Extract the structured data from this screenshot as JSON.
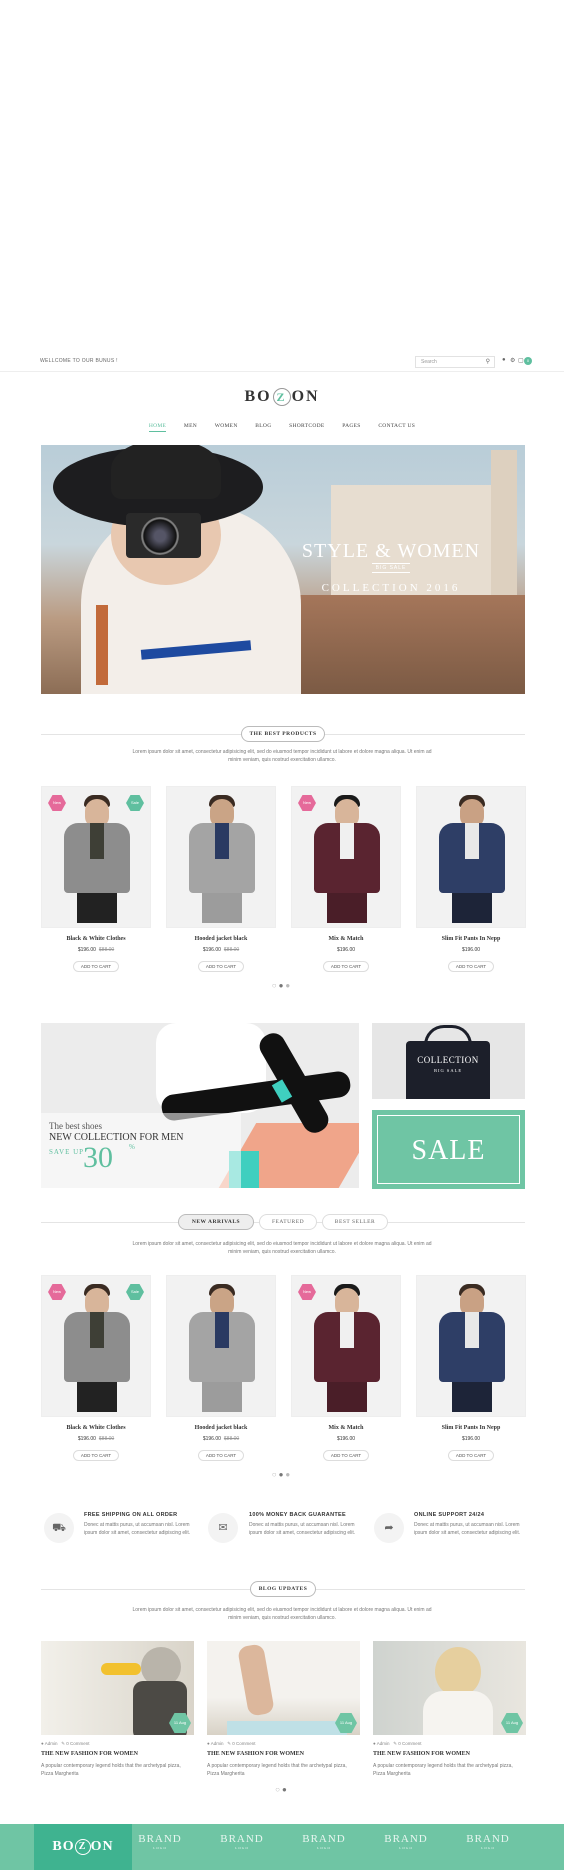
{
  "topbar": {
    "welcome": "WELLCOME TO OUR BUNUS !",
    "search_placeholder": "Search"
  },
  "logo": {
    "left": "BO",
    "center": "Z",
    "right": "ON"
  },
  "nav": [
    "HOME",
    "MEN",
    "WOMEN",
    "BLOG",
    "SHORTCODE",
    "PAGES",
    "CONTACT US"
  ],
  "hero": {
    "title": "STYLE & WOMEN",
    "subtitle": "BIG SALE",
    "collection": "COLLECTION 2016"
  },
  "best_products": {
    "heading": "THE BEST PRODUCTS",
    "description": "Lorem ipsum dolor sit amet, consectetur adipisicing elit, sed do eiusmod tempor incididunt ut labore et dolore magna aliqua. Ut enim ad minim veniam, quis nostrud exercitation ullamco."
  },
  "products": [
    {
      "name": "Black & White Clothes",
      "price": "$196.00",
      "old_price": "$88.00",
      "button": "ADD TO CART",
      "badges": [
        "New",
        "Sale"
      ]
    },
    {
      "name": "Hooded jacket black",
      "price": "$196.00",
      "old_price": "$88.00",
      "button": "ADD TO CART",
      "badges": []
    },
    {
      "name": "Mix & Match",
      "price": "$196.00",
      "old_price": "",
      "button": "ADD TO CART",
      "badges": [
        "New"
      ]
    },
    {
      "name": "Slim Fit Pants In Nepp",
      "price": "$196.00",
      "old_price": "",
      "button": "ADD TO CART",
      "badges": []
    }
  ],
  "promo": {
    "shoes_line1": "The best shoes",
    "shoes_line2": "NEW COLLECTION FOR MEN",
    "shoes_save": "SAVE UP",
    "shoes_percent": "30",
    "shoes_percent_sign": "%",
    "bag_title": "COLLECTION",
    "bag_sub": "BIG SALE",
    "sale": "SALE"
  },
  "tabs": [
    "NEW ARRIVALS",
    "FEATURED",
    "BEST SELLER"
  ],
  "tabs_description": "Lorem ipsum dolor sit amet, consectetur adipisicing elit, sed do eiusmod tempor incididunt ut labore et dolore magna aliqua. Ut enim ad minim veniam, quis nostrud exercitation ullamco.",
  "features": [
    {
      "icon": "truck-icon",
      "title": "FREE SHIPPING ON ALL ORDER",
      "text": "Donec at mattis purus, ut accumsan nisl. Lorem ipsum dolor sit amet, consectetur adipiscing elit."
    },
    {
      "icon": "chat-icon",
      "title": "100% MONEY BACK GUARANTEE",
      "text": "Donec at mattis purus, ut accumsan nisl. Lorem ipsum dolor sit amet, consectetur adipiscing elit."
    },
    {
      "icon": "share-icon",
      "title": "ONLINE SUPPORT 24/24",
      "text": "Donec at mattis purus, ut accumsan nisl. Lorem ipsum dolor sit amet, consectetur adipiscing elit."
    }
  ],
  "blog": {
    "heading": "BLOG UPDATES",
    "description": "Lorem ipsum dolor sit amet, consectetur adipisicing elit, sed do eiusmod tempor incididunt ut labore et dolore magna aliqua. Ut enim ad minim veniam, quis nostrud exercitation ullamco.",
    "posts": [
      {
        "author": "Admin",
        "comments": "0 Comment",
        "title": "THE NEW FASHION FOR WOMEN",
        "text": "A popular contemporary legend holds that the archetypal pizza, Pizza Margherita",
        "date": "11 Aug"
      },
      {
        "author": "Admin",
        "comments": "0 Comment",
        "title": "THE NEW FASHION FOR WOMEN",
        "text": "A popular contemporary legend holds that the archetypal pizza, Pizza Margherita",
        "date": "11 Aug"
      },
      {
        "author": "Admin",
        "comments": "0 Comment",
        "title": "THE NEW FASHION FOR WOMEN",
        "text": "A popular contemporary legend holds that the archetypal pizza, Pizza Margherita",
        "date": "11 Aug"
      }
    ]
  },
  "brands": {
    "label": "BRAND",
    "sub": "LOGO"
  },
  "colors": {
    "accent": "#6fc5a4",
    "badge_pink": "#e56a9a"
  }
}
